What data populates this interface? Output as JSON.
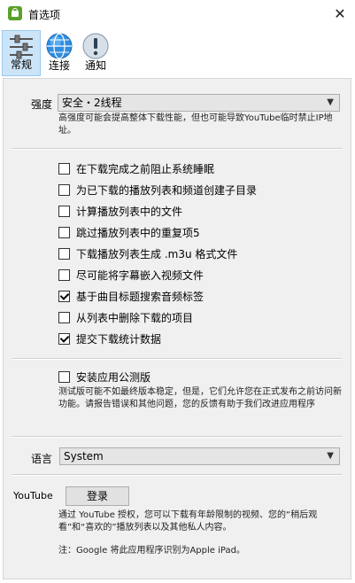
{
  "window": {
    "title": "首选项",
    "close_glyph": "✕"
  },
  "toolbar": {
    "tabs": [
      {
        "label": "常规",
        "icon": "sliders-icon",
        "active": true
      },
      {
        "label": "连接",
        "icon": "globe-icon",
        "active": false
      },
      {
        "label": "通知",
        "icon": "exclamation-icon",
        "active": false
      }
    ]
  },
  "strength": {
    "label": "强度",
    "selected": "安全・2线程",
    "hint": "高强度可能会提高整体下载性能，但也可能导致YouTube临时禁止IP地址。"
  },
  "options": [
    {
      "label": "在下载完成之前阻止系统睡眠",
      "checked": false
    },
    {
      "label": "为已下载的播放列表和频道创建子目录",
      "checked": false
    },
    {
      "label": "计算播放列表中的文件",
      "checked": false
    },
    {
      "label": "跳过播放列表中的重复项5",
      "checked": false
    },
    {
      "label": "下载播放列表生成 .m3u 格式文件",
      "checked": false
    },
    {
      "label": "尽可能将字幕嵌入视频文件",
      "checked": false
    },
    {
      "label": "基于曲目标题搜索音频标签",
      "checked": true
    },
    {
      "label": "从列表中删除下载的项目",
      "checked": false
    },
    {
      "label": "提交下载统计数据",
      "checked": true
    }
  ],
  "beta": {
    "label": "安装应用公测版",
    "checked": false,
    "hint": "测试版可能不如最终版本稳定，但是，它们允许您在正式发布之前访问新功能。请报告错误和其他问题，您的反馈有助于我们改进应用程序"
  },
  "language": {
    "label": "语言",
    "selected": "System"
  },
  "youtube": {
    "label": "YouTube",
    "login_label": "登录",
    "hint": "通过 YouTube 授权，您可以下载有年龄限制的视频、您的“稍后观看”和“喜欢的”播放列表以及其他私人内容。",
    "note": "注：Google 将此应用程序识别为Apple iPad。"
  }
}
